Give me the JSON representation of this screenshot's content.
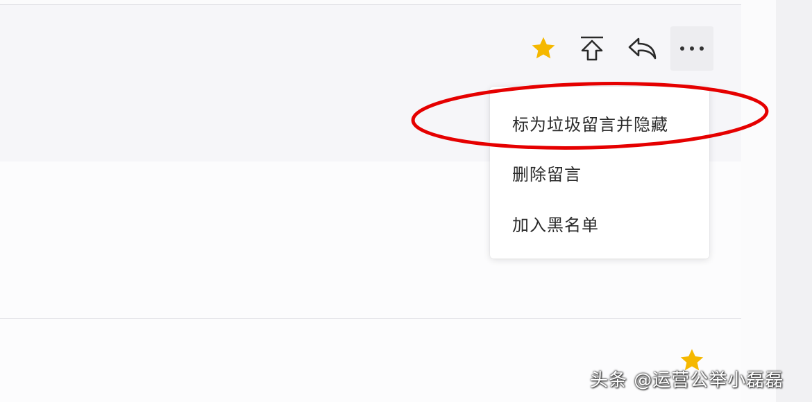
{
  "toolbar": {
    "buttons": [
      {
        "icon": "star-icon",
        "color": "#f5b800"
      },
      {
        "icon": "pin-to-top-icon"
      },
      {
        "icon": "reply-icon"
      },
      {
        "icon": "more-icon"
      }
    ]
  },
  "menu": {
    "items": [
      {
        "label": "标为垃圾留言并隐藏"
      },
      {
        "label": "删除留言"
      },
      {
        "label": "加入黑名单"
      }
    ]
  },
  "watermark": {
    "text": "头条 @运营公举小磊磊"
  },
  "colors": {
    "highlight": "#e50000",
    "star": "#f5b800"
  }
}
